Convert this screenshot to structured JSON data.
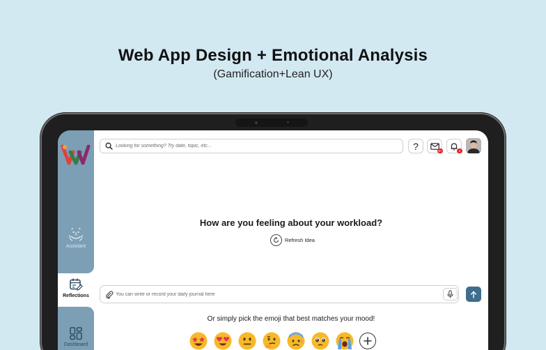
{
  "hero": {
    "title": "Web App Design + Emotional Analysis",
    "subtitle": "(Gamification+Lean UX)"
  },
  "sidebar": {
    "items": [
      {
        "label": "Assistant",
        "icon": "assistant-face-icon"
      },
      {
        "label": "Reflections",
        "icon": "calendar-edit-icon",
        "active": true
      },
      {
        "label": "Dashboard",
        "icon": "dashboard-grid-icon"
      }
    ]
  },
  "header": {
    "search_placeholder": "Looking for something? Try date, topic, etc...",
    "help_label": "?",
    "mail_badge": "9+",
    "bell_badge": "2"
  },
  "main": {
    "question": "How are you feeling about your workload?",
    "refresh_label": "Refresh Idea",
    "journal_placeholder": "You can write or record your daily journal here",
    "emoji_prompt": "Or simply pick the emoji that best matches your mood!",
    "emojis": [
      "star-struck-emoji",
      "heart-eyes-emoji",
      "neutral-face-emoji",
      "thinking-face-emoji",
      "sad-sweat-emoji",
      "pleading-face-emoji",
      "crying-face-emoji"
    ]
  },
  "colors": {
    "background": "#d3e9f2",
    "sidebar": "#7c9fb6",
    "send_button": "#3e6e8e",
    "badge": "#e02424"
  }
}
